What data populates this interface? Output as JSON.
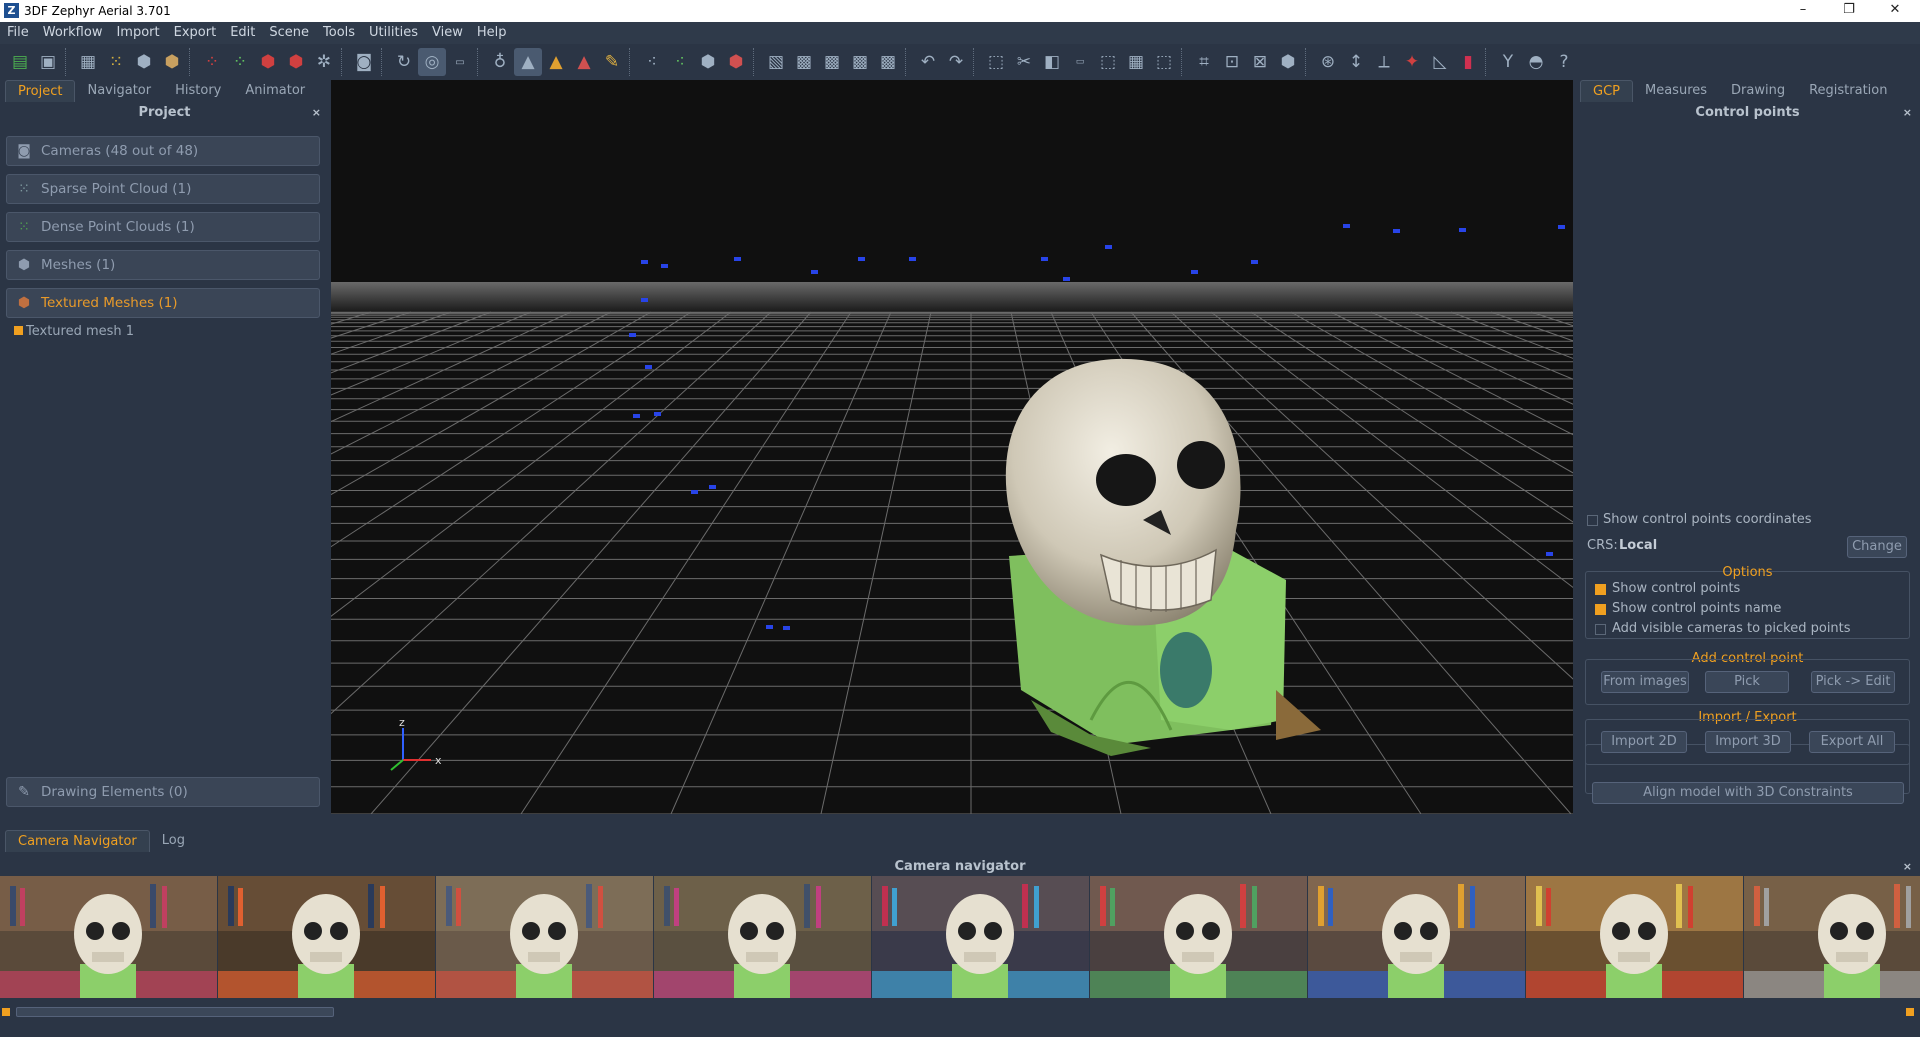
{
  "window": {
    "title": "3DF Zephyr Aerial 3.701",
    "logo": "Z",
    "min": "–",
    "max": "❐",
    "close": "✕"
  },
  "menu": [
    "File",
    "Workflow",
    "Import",
    "Export",
    "Edit",
    "Scene",
    "Tools",
    "Utilities",
    "View",
    "Help"
  ],
  "left_tabs": [
    "Project",
    "Navigator",
    "History",
    "Animator"
  ],
  "left_panel": {
    "title": "Project",
    "close": "×",
    "items": [
      {
        "label": "Cameras (48 out of 48)",
        "icon": "camera-icon"
      },
      {
        "label": "Sparse Point Cloud (1)",
        "icon": "sparse-cloud-icon"
      },
      {
        "label": "Dense Point Clouds (1)",
        "icon": "dense-cloud-icon"
      },
      {
        "label": "Meshes (1)",
        "icon": "mesh-icon"
      },
      {
        "label": "Textured Meshes (1)",
        "icon": "textured-mesh-icon"
      }
    ],
    "subitem": "Textured mesh 1",
    "drawing": "Drawing Elements (0)"
  },
  "right_tabs": [
    "GCP",
    "Measures",
    "Drawing",
    "Registration"
  ],
  "right_panel": {
    "title": "Control points",
    "close": "×",
    "show_coords": "Show control points coordinates",
    "crs_label": "CRS:",
    "crs_value": "Local",
    "change": "Change",
    "options_title": "Options",
    "options": [
      {
        "label": "Show control points",
        "checked": true
      },
      {
        "label": "Show control points name",
        "checked": true
      },
      {
        "label": "Add visible cameras to picked points",
        "checked": false
      }
    ],
    "add_title": "Add control point",
    "add_buttons": [
      "From images",
      "Pick",
      "Pick -> Edit"
    ],
    "io_title": "Import / Export",
    "io_buttons": [
      "Import 2D",
      "Import 3D",
      "Export All"
    ],
    "align": "Align model with 3D Constraints"
  },
  "axis": {
    "z": "z",
    "x": "x"
  },
  "bottom_tabs": [
    "Camera Navigator",
    "Log"
  ],
  "camera_navigator": {
    "title": "Camera navigator",
    "close": "×"
  },
  "colors": {
    "accent": "#f0a020",
    "panel": "#2b3545",
    "viewport": "#101010"
  }
}
